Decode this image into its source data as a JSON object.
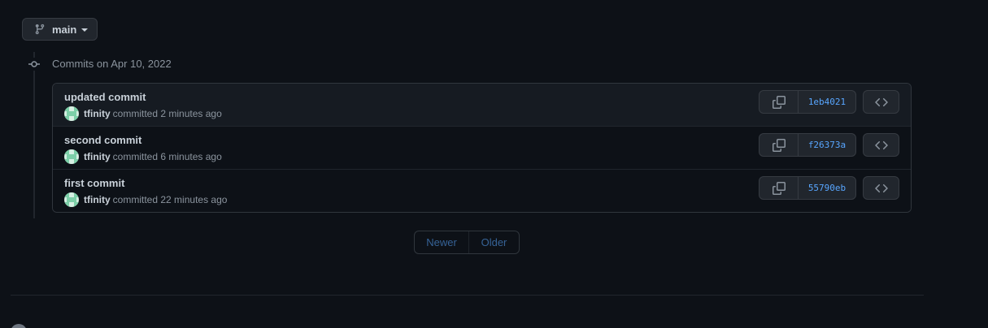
{
  "branch": {
    "name": "main"
  },
  "timeline": {
    "heading": "Commits on Apr 10, 2022"
  },
  "commits": [
    {
      "title": "updated commit",
      "author": "tfinity",
      "action": "committed",
      "time": "2 minutes ago",
      "sha": "1eb4021"
    },
    {
      "title": "second commit",
      "author": "tfinity",
      "action": "committed",
      "time": "6 minutes ago",
      "sha": "f26373a"
    },
    {
      "title": "first commit",
      "author": "tfinity",
      "action": "committed",
      "time": "22 minutes ago",
      "sha": "55790eb"
    }
  ],
  "pagination": {
    "newer": "Newer",
    "older": "Older"
  },
  "icons": {
    "branch": "git-branch-icon",
    "commit_node": "git-commit-icon",
    "copy": "copy-icon",
    "browse": "code-icon",
    "caret": "triangle-down-icon"
  },
  "colors": {
    "background": "#0d1117",
    "link": "#58a6ff",
    "muted": "#8b949e",
    "border": "#30363d"
  }
}
